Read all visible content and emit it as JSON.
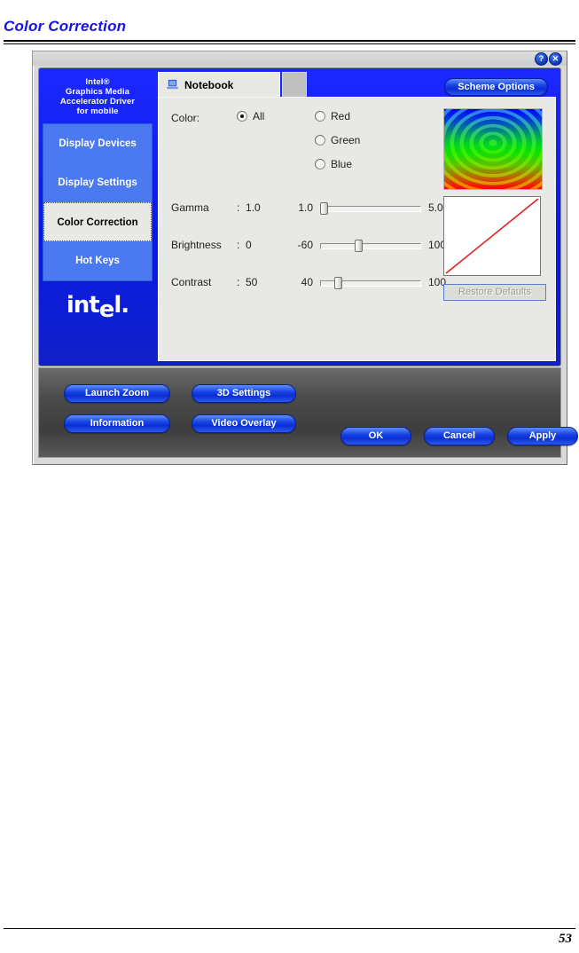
{
  "page": {
    "heading": "Color Correction",
    "number": "53"
  },
  "dialog": {
    "titlebar": {
      "help_label": "?",
      "close_label": "✕"
    },
    "sidebar": {
      "brand": {
        "line1": "Intel®",
        "line2": "Graphics Media",
        "line3": "Accelerator Driver",
        "line4": "for mobile"
      },
      "items": [
        {
          "label": "Display Devices",
          "selected": false
        },
        {
          "label": "Display Settings",
          "selected": false
        },
        {
          "label": "Color Correction",
          "selected": true
        },
        {
          "label": "Hot Keys",
          "selected": false
        }
      ],
      "logo": {
        "part1": "int",
        "part2": "e",
        "part3": "l."
      }
    },
    "tabs": [
      {
        "label": "Notebook",
        "icon": "laptop-icon",
        "active": true
      }
    ],
    "scheme_options_label": "Scheme Options",
    "color": {
      "label": "Color:",
      "options": [
        {
          "label": "All",
          "checked": true
        },
        {
          "label": "Red",
          "checked": false
        },
        {
          "label": "Green",
          "checked": false
        },
        {
          "label": "Blue",
          "checked": false
        }
      ]
    },
    "sliders": [
      {
        "name": "Gamma",
        "colon": ":",
        "value": "1.0",
        "min": "1.0",
        "max": "5.0",
        "percent": 0
      },
      {
        "name": "Brightness",
        "colon": ":",
        "value": "0",
        "min": "-60",
        "max": "100",
        "percent": 37
      },
      {
        "name": "Contrast",
        "colon": ":",
        "value": "50",
        "min": "40",
        "max": "100",
        "percent": 15
      }
    ],
    "preview": {
      "gradient_name": "color-gradient-preview",
      "curve_name": "gamma-curve-preview",
      "curve_color": "#e02020"
    },
    "restore_defaults_label": "Restore Defaults",
    "bottom_buttons": [
      {
        "label": "Launch Zoom"
      },
      {
        "label": "3D Settings"
      },
      {
        "label": "Information"
      },
      {
        "label": "Video Overlay"
      },
      {
        "label": "OK"
      },
      {
        "label": "Cancel"
      },
      {
        "label": "Apply"
      }
    ]
  },
  "colors": {
    "heading": "#1414e6",
    "frame_blue": "#0a1ae6",
    "nav_blue": "#4b79f0",
    "panel_gray": "#e8e8e4",
    "bottom_bar": "#4a4a4a"
  }
}
